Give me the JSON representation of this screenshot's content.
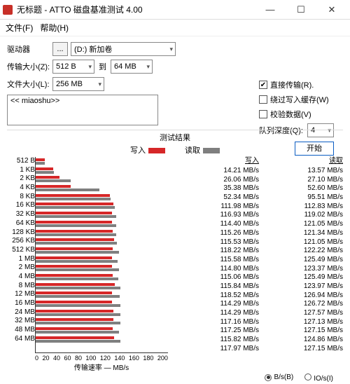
{
  "window": {
    "title": "无标题 - ATTO 磁盘基准测试 4.00"
  },
  "menu": {
    "file": "文件(F)",
    "help": "帮助(H)"
  },
  "cfg": {
    "drive_label": "驱动器",
    "drive_btn": "...",
    "drive_value": "(D:) 新加卷",
    "tsize_label": "传输大小(Z):",
    "tsize_from": "512 B",
    "to": "到",
    "tsize_to": "64 MB",
    "fsize_label": "文件大小(L):",
    "fsize_value": "256 MB"
  },
  "opts": {
    "direct": "直接传输(R).",
    "bypass": "绕过写入缓存(W)",
    "verify": "校验数据(V)",
    "depth_label": "队列深度(Q):",
    "depth_value": "4"
  },
  "start": "开始",
  "desc": "<< miaoshu>>",
  "res": {
    "title": "测试结果",
    "write": "写入",
    "read": "读取",
    "xlabel": "传输速率 — MB/s"
  },
  "unit": {
    "bps": "B/s(B)",
    "iops": "IO/s(I)"
  },
  "xticks": [
    "0",
    "20",
    "40",
    "60",
    "80",
    "100",
    "120",
    "140",
    "160",
    "180",
    "200"
  ],
  "chart_data": {
    "type": "bar",
    "xlabel": "传输速率 — MB/s",
    "xlim": [
      0,
      200
    ],
    "categories": [
      "512 B",
      "1 KB",
      "2 KB",
      "4 KB",
      "8 KB",
      "16 KB",
      "32 KB",
      "64 KB",
      "128 KB",
      "256 KB",
      "512 KB",
      "1 MB",
      "2 MB",
      "4 MB",
      "8 MB",
      "12 MB",
      "16 MB",
      "24 MB",
      "32 MB",
      "48 MB",
      "64 MB"
    ],
    "series": [
      {
        "name": "写入",
        "color": "#d62728",
        "values": [
          14.21,
          26.06,
          35.38,
          52.34,
          111.98,
          116.93,
          114.4,
          115.26,
          115.53,
          118.22,
          115.58,
          114.8,
          115.06,
          115.84,
          118.52,
          114.29,
          114.29,
          117.16,
          117.25,
          115.82,
          117.97
        ]
      },
      {
        "name": "读取",
        "color": "#7f7f7f",
        "values": [
          13.57,
          27.1,
          52.6,
          95.51,
          112.83,
          119.02,
          121.05,
          121.34,
          121.05,
          122.22,
          125.49,
          123.37,
          125.49,
          123.97,
          126.94,
          126.72,
          127.57,
          127.13,
          127.15,
          124.86,
          127.15
        ]
      }
    ],
    "unit": "MB/s"
  }
}
